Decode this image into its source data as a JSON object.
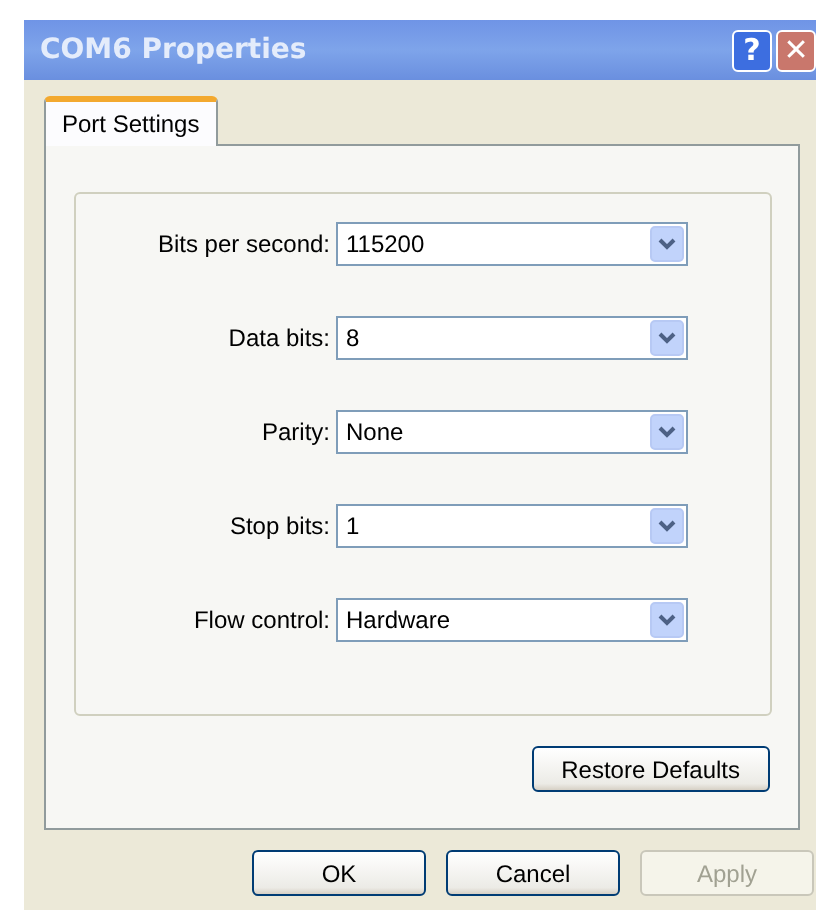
{
  "window": {
    "title": "COM6 Properties",
    "title_buttons": [
      {
        "kind": "help",
        "label": "?"
      },
      {
        "kind": "close",
        "label": "✕"
      }
    ]
  },
  "tabs": [
    {
      "label": "Port Settings",
      "selected": true
    }
  ],
  "fields": [
    {
      "label": "Bits per second:",
      "value": "115200"
    },
    {
      "label": "Data bits:",
      "value": "8"
    },
    {
      "label": "Parity:",
      "value": "None"
    },
    {
      "label": "Stop bits:",
      "value": "1"
    },
    {
      "label": "Flow control:",
      "value": "Hardware"
    }
  ],
  "restore_button": {
    "label": "Restore Defaults",
    "disabled": false
  },
  "buttons": [
    {
      "label": "OK",
      "disabled": false
    },
    {
      "label": "Cancel",
      "disabled": false
    },
    {
      "label": "Apply",
      "disabled": true
    }
  ]
}
